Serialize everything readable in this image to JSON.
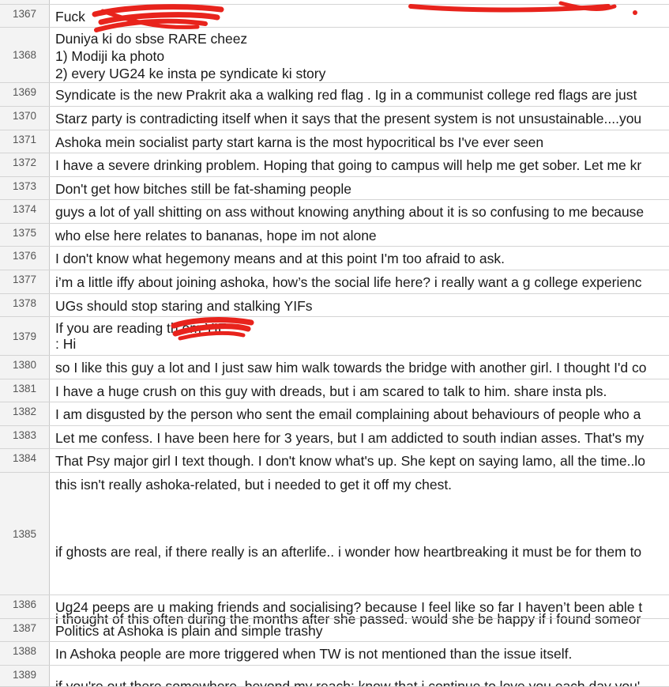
{
  "rows": [
    {
      "num": "1367",
      "lines": [
        "Fuck"
      ]
    },
    {
      "num": "1368",
      "lines": [
        "Duniya ki do sbse RARE cheez",
        "1) Modiji ka photo",
        "2) every UG24 ke insta pe syndicate ki story"
      ]
    },
    {
      "num": "1369",
      "lines": [
        "Syndicate is the new Prakrit aka a walking red flag . Ig in a communist college red flags are just"
      ]
    },
    {
      "num": "1370",
      "lines": [
        "Starz party is contradicting itself when it says that the present system is not unsustainable....you"
      ]
    },
    {
      "num": "1371",
      "lines": [
        "Ashoka mein socialist party start karna is the most hypocritical bs I've ever seen"
      ]
    },
    {
      "num": "1372",
      "lines": [
        "I have a severe drinking problem. Hoping that going to campus will help me get sober. Let me kr"
      ]
    },
    {
      "num": "1373",
      "lines": [
        "Don't get how bitches still be fat-shaming people"
      ]
    },
    {
      "num": "1374",
      "lines": [
        "guys a lot of yall shitting on ass without knowing anything about it is so confusing to me because"
      ]
    },
    {
      "num": "1375",
      "lines": [
        "who else here relates to bananas, hope im not alone"
      ]
    },
    {
      "num": "1376",
      "lines": [
        "I don't know what hegemony means and at this point I'm too afraid to ask."
      ]
    },
    {
      "num": "1377",
      "lines": [
        "i’m a little iffy about joining ashoka, how’s the social life here? i really want a g college experienc"
      ]
    },
    {
      "num": "1378",
      "lines": [
        "UGs should stop staring and stalking YIFs"
      ]
    },
    {
      "num": "1379",
      "lines": [
        "If you are reading th          om YIF,",
        ": Hi"
      ]
    },
    {
      "num": "1380",
      "lines": [
        "so I like this guy a lot and I just saw him walk towards the bridge with another girl. I thought I'd co"
      ]
    },
    {
      "num": "1381",
      "lines": [
        "I have a huge crush on this guy with dreads, but i am scared to talk to him. share insta pls."
      ]
    },
    {
      "num": "1382",
      "lines": [
        "I am disgusted by the person who sent the email complaining about behaviours of people who a"
      ]
    },
    {
      "num": "1383",
      "lines": [
        "Let me confess. I have been here for 3 years, but I am addicted to south indian asses. That's my"
      ]
    },
    {
      "num": "1384",
      "lines": [
        "That Psy major girl I text though. I don't know what's up. She kept on saying lamo, all the time..lo"
      ]
    },
    {
      "num": "1385",
      "lines": [
        "this isn't really ashoka-related, but i needed to get it off my chest.",
        "",
        "if ghosts are real, if there really is an afterlife.. i wonder how heartbreaking it must be for them to",
        "",
        "i thought of this often during the months after she passed. would she be happy if i found someor",
        "",
        "if you're out there somewhere, beyond my reach: know that i continue to love you each day you'"
      ]
    },
    {
      "num": "1386",
      "lines": [
        "Ug24 peeps are u making friends and socialising? because I feel like so far I haven’t been able t"
      ]
    },
    {
      "num": "1387",
      "lines": [
        "Politics at Ashoka is plain and simple trashy"
      ]
    },
    {
      "num": "1388",
      "lines": [
        "In Ashoka people are more triggered when TW is not mentioned than the issue itself."
      ]
    },
    {
      "num": "1389",
      "lines": []
    }
  ],
  "colors": {
    "redaction": "#e8231c",
    "row_header_bg": "#f3f3f3",
    "grid": "#d4d4d4",
    "text": "#1a1a1a",
    "row_number_text": "#555555"
  }
}
